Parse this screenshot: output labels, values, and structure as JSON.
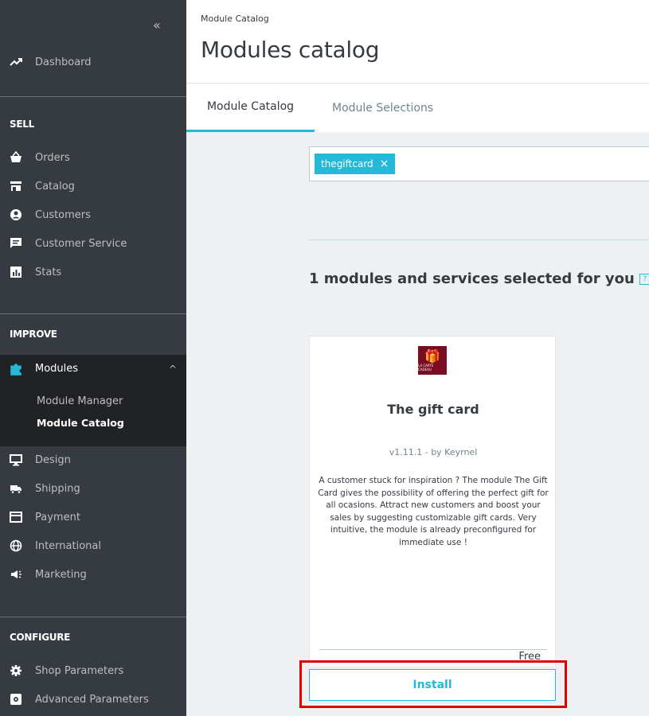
{
  "sidebar": {
    "collapse_glyph": "«",
    "dashboard": {
      "label": "Dashboard",
      "icon": "trending-up-icon"
    },
    "sections": {
      "sell": "SELL",
      "improve": "IMPROVE",
      "configure": "CONFIGURE"
    },
    "sell_items": [
      {
        "label": "Orders",
        "icon": "basket-icon"
      },
      {
        "label": "Catalog",
        "icon": "store-icon"
      },
      {
        "label": "Customers",
        "icon": "account-circle-icon"
      },
      {
        "label": "Customer Service",
        "icon": "chat-icon"
      },
      {
        "label": "Stats",
        "icon": "bar-chart-icon"
      }
    ],
    "modules": {
      "label": "Modules",
      "icon": "puzzle-icon",
      "chevron": "^"
    },
    "modules_sub": [
      {
        "label": "Module Manager"
      },
      {
        "label": "Module Catalog"
      }
    ],
    "improve_items": [
      {
        "label": "Design",
        "icon": "desktop-icon"
      },
      {
        "label": "Shipping",
        "icon": "truck-icon"
      },
      {
        "label": "Payment",
        "icon": "credit-card-icon"
      },
      {
        "label": "International",
        "icon": "globe-icon"
      },
      {
        "label": "Marketing",
        "icon": "megaphone-icon"
      }
    ],
    "configure_items": [
      {
        "label": "Shop Parameters",
        "icon": "gear-icon"
      },
      {
        "label": "Advanced Parameters",
        "icon": "settings-applications-icon"
      }
    ]
  },
  "header": {
    "breadcrumb": "Module Catalog",
    "title": "Modules catalog"
  },
  "tabs": [
    {
      "label": "Module Catalog",
      "active": true
    },
    {
      "label": "Module Selections",
      "active": false
    }
  ],
  "search": {
    "tag": "thegiftcard",
    "remove_glyph": "×"
  },
  "results": {
    "title": "1 modules and services selected for you",
    "help_glyph": "?"
  },
  "module_card": {
    "logo_text": "LA CARTE CADEAU",
    "name": "The gift card",
    "version": "v1.11.1 - by Keyrnel",
    "description": "A customer stuck for inspiration ? The module The Gift Card gives the possibility of offering the perfect gift for all ocasions. Attract new customers and boost your sales by suggesting customizable gift cards. Very intuitive, the module is already preconfigured for immediate use !",
    "price": "Free",
    "install_label": "Install"
  },
  "colors": {
    "sidebar_bg": "#363a41",
    "sidebar_active_bg": "#202226",
    "accent": "#25b9d7",
    "highlight": "#e10000",
    "logo_bg": "#7a0b21"
  }
}
